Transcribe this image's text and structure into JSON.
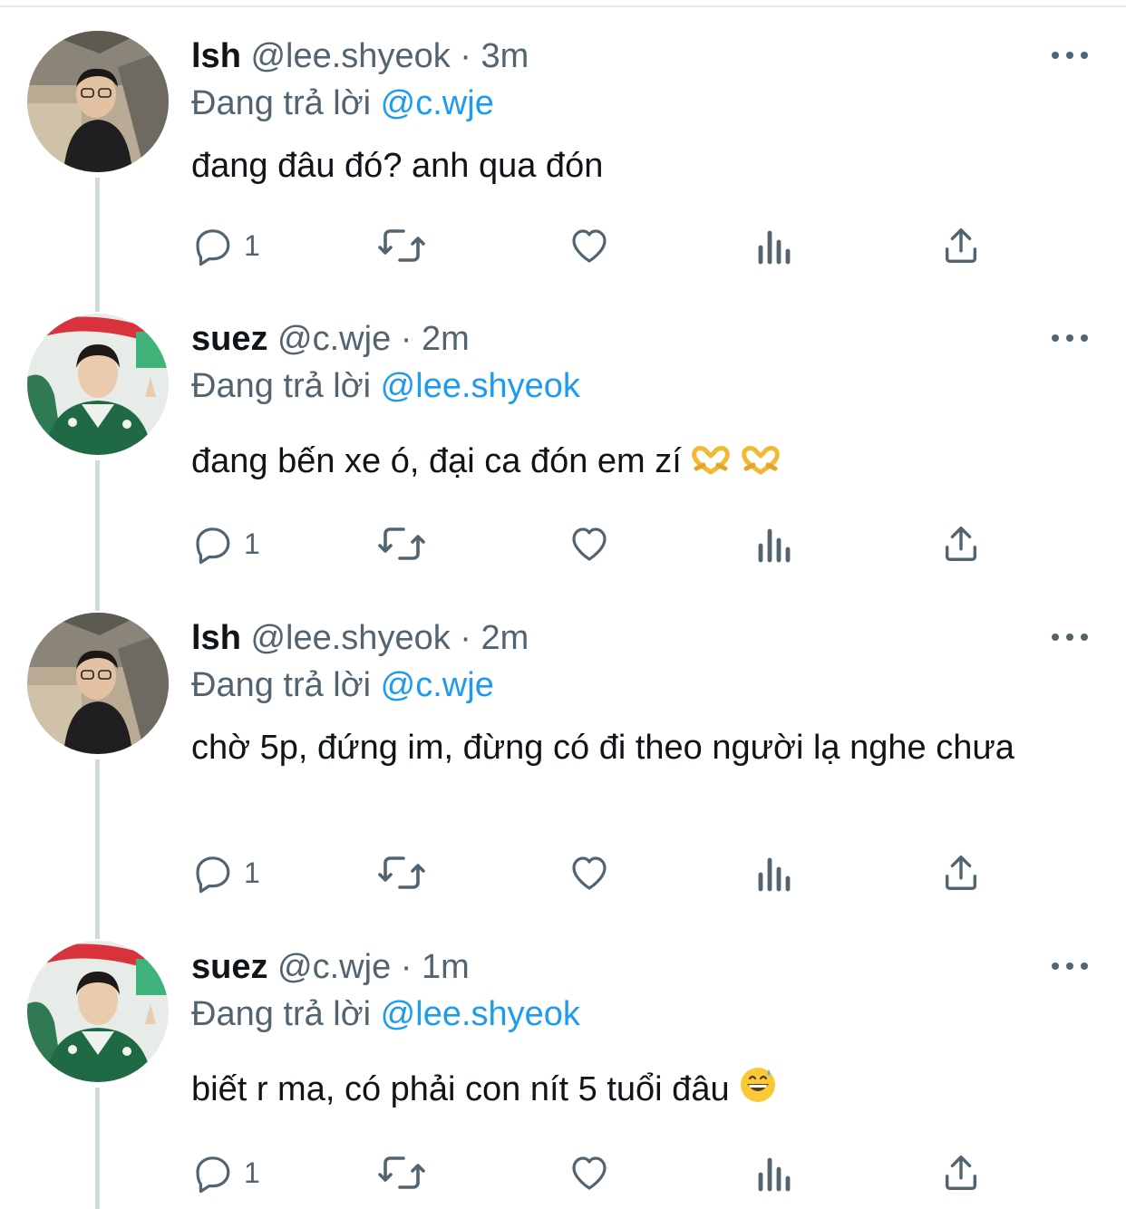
{
  "tweets": [
    {
      "name": "lsh",
      "handle": "@lee.shyeok",
      "separator": "·",
      "time": "3m",
      "reply_prefix": "Đang trả lời",
      "reply_to": "@c.wje",
      "text": "đang đâu đó? anh qua đón",
      "reply_count": "1",
      "avatar_icon": "lsh-avatar"
    },
    {
      "name": "suez",
      "handle": "@c.wje",
      "separator": "·",
      "time": "2m",
      "reply_prefix": "Đang trả lời",
      "reply_to": "@lee.shyeok",
      "text": "đang bến xe ó, đại ca đón em zí",
      "emoji": "heart-hands-emoji heart-hands-emoji",
      "reply_count": "1",
      "avatar_icon": "suez-avatar"
    },
    {
      "name": "lsh",
      "handle": "@lee.shyeok",
      "separator": "·",
      "time": "2m",
      "reply_prefix": "Đang trả lời",
      "reply_to": "@c.wje",
      "text": "chờ 5p, đứng im, đừng có đi theo người lạ nghe chưa",
      "reply_count": "1",
      "avatar_icon": "lsh-avatar"
    },
    {
      "name": "suez",
      "handle": "@c.wje",
      "separator": "·",
      "time": "1m",
      "reply_prefix": "Đang trả lời",
      "reply_to": "@lee.shyeok",
      "text": "biết r ma, có phải con nít 5 tuổi đâu",
      "emoji": "grinning-sweat-emoji",
      "reply_count": "1",
      "avatar_icon": "suez-avatar"
    }
  ],
  "colors": {
    "name": "#0f1419",
    "secondary": "#536471",
    "mention": "#1d9bf0",
    "thread_line": "#cfd9de"
  }
}
